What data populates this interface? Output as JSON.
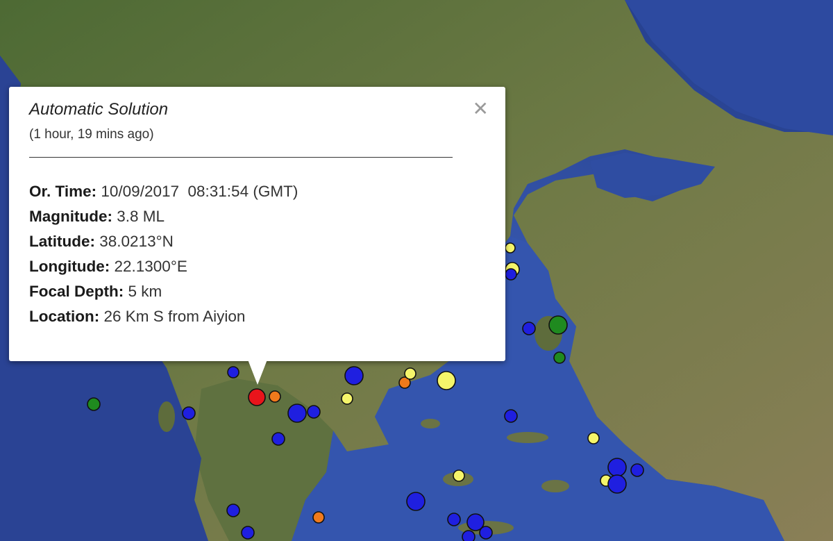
{
  "popup": {
    "title": "Automatic Solution",
    "time_ago": "(1 hour, 19 mins ago)",
    "close_symbol": "✕",
    "fields": [
      {
        "label": "Or. Time:",
        "value": "10/09/2017  08:31:54 (GMT)"
      },
      {
        "label": "Magnitude:",
        "value": "3.8 ML"
      },
      {
        "label": "Latitude:",
        "value": "38.0213°N"
      },
      {
        "label": "Longitude:",
        "value": "22.1300°E"
      },
      {
        "label": "Focal Depth:",
        "value": "5 km"
      },
      {
        "label": "Location:",
        "value": "26 Km S from Aiyion"
      }
    ]
  },
  "marker_colors": {
    "selected": "#e8141b",
    "blue": "#1f1fe0",
    "yellow": "#f5f56a",
    "orange": "#f07a1c",
    "green": "#1f8a1f"
  },
  "map_colors": {
    "sea_deep": "#26408e",
    "sea": "#3457b0",
    "land_dark": "#4a6a34",
    "land": "#6d7a45",
    "land_dry": "#8c8056"
  }
}
